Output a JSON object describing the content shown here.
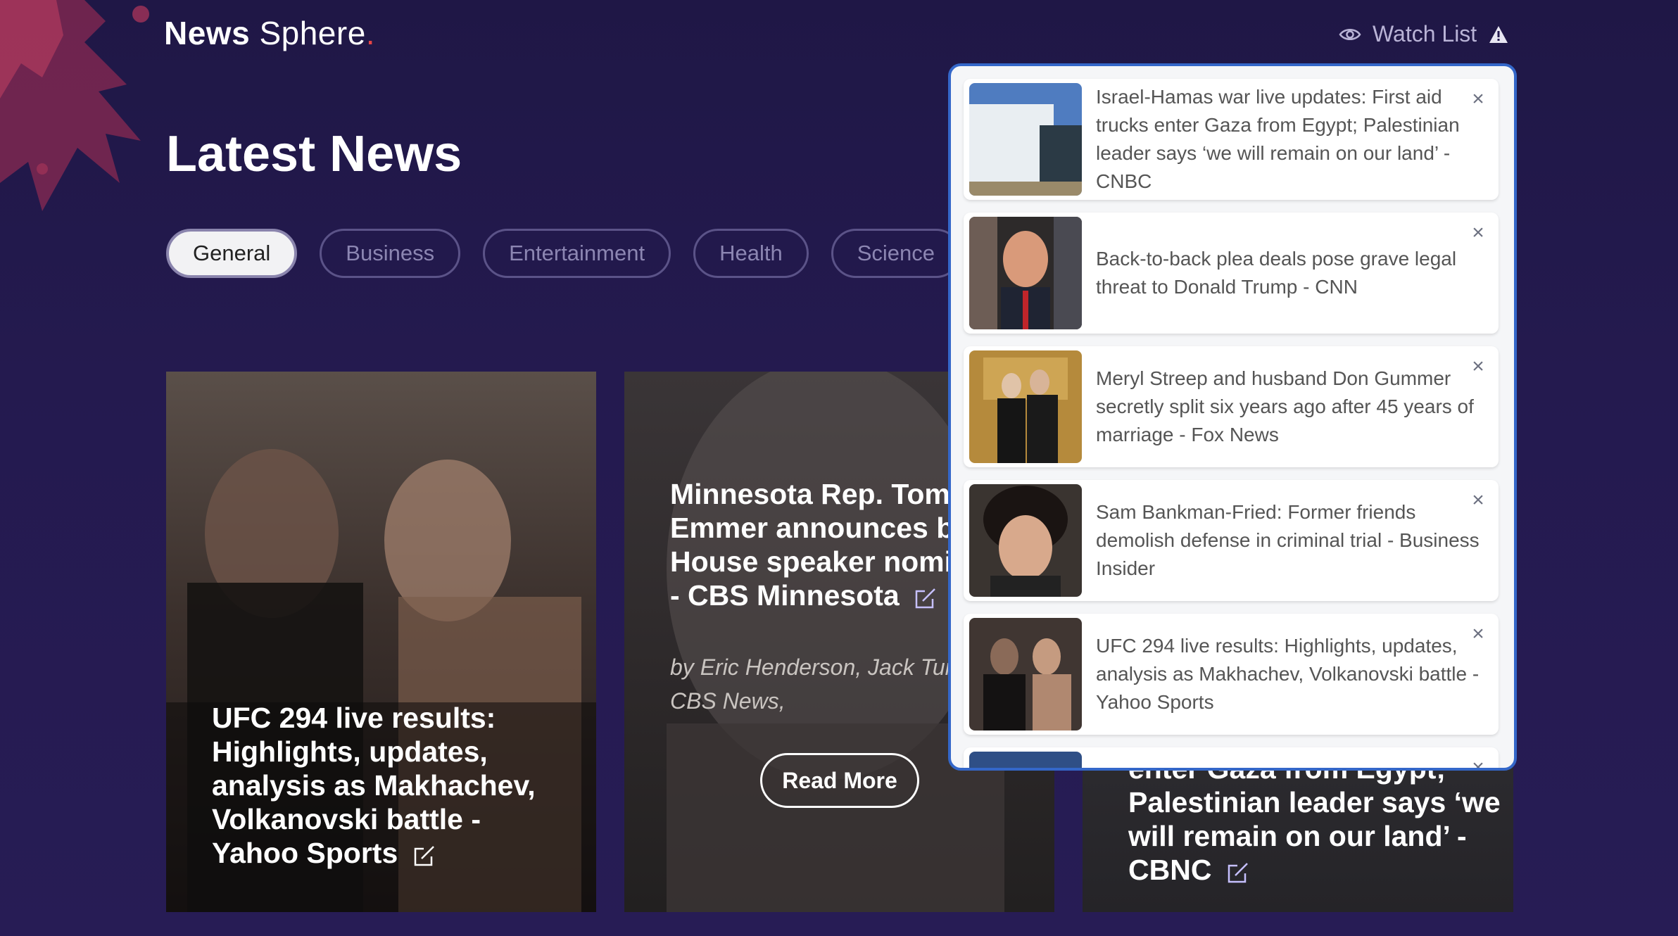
{
  "header": {
    "logo_bold": "News",
    "logo_rest": " Sphere",
    "logo_dot": ".",
    "watch_label": "Watch List"
  },
  "page_title": "Latest News",
  "categories": [
    {
      "label": "General",
      "active": true
    },
    {
      "label": "Business",
      "active": false
    },
    {
      "label": "Entertainment",
      "active": false
    },
    {
      "label": "Health",
      "active": false
    },
    {
      "label": "Science",
      "active": false
    }
  ],
  "cards": [
    {
      "title": "UFC 294 live results: Highlights, updates, analysis as Makhachev, Volkanovski battle - Yahoo Sports"
    },
    {
      "title": "Minnesota Rep. Tom Emmer announces bid for House speaker nomination - CBS Minnesota",
      "byline_1": "by Eric Henderson, Jack Tur",
      "byline_2": "CBS News,",
      "read_more": "Read More"
    },
    {
      "title": "enter Gaza from Egypt; Palestinian leader says ‘we will remain on our land’ - CBNC"
    }
  ],
  "watchlist": [
    {
      "text": "Israel-Hamas war live updates: First aid trucks enter Gaza from Egypt; Palestinian leader says ‘we will remain on our land’ - CNBC",
      "close": "×"
    },
    {
      "text": "Back-to-back plea deals pose grave legal threat to Donald Trump - CNN",
      "close": "×"
    },
    {
      "text": "Meryl Streep and husband Don Gummer secretly split six years ago after 45 years of marriage - Fox News",
      "close": "×"
    },
    {
      "text": "Sam Bankman-Fried: Former friends demolish defense in criminal trial - Business Insider",
      "close": "×"
    },
    {
      "text": "UFC 294 live results: Highlights, updates, analysis as Makhachev, Volkanovski battle - Yahoo Sports",
      "close": "×"
    },
    {
      "text": "",
      "close": "×"
    }
  ],
  "colors": {
    "background": "#241a4f",
    "popup_border": "#3467c9",
    "logo_dot": "#e64545",
    "pill_border": "#5b5388"
  }
}
